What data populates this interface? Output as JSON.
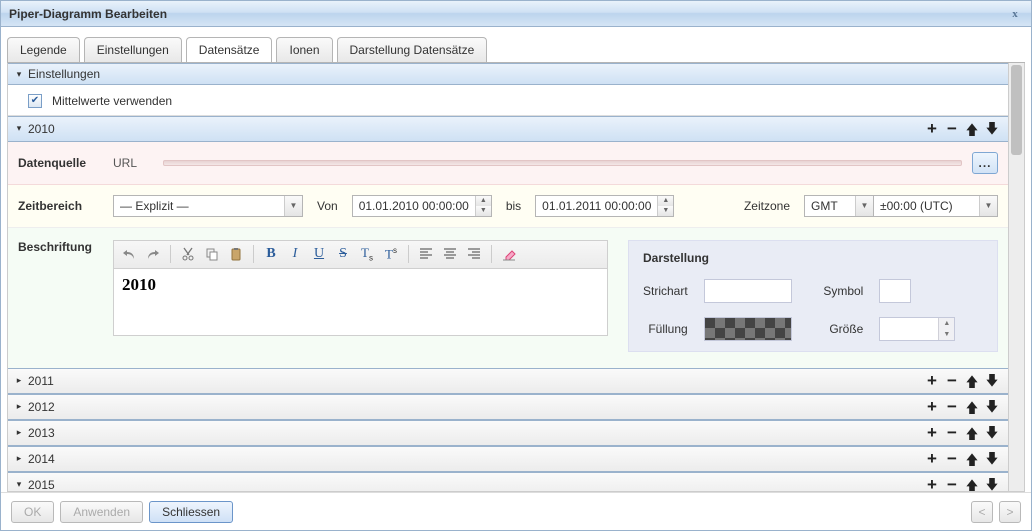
{
  "window": {
    "title": "Piper-Diagramm Bearbeiten",
    "close": "x"
  },
  "tabs": [
    "Legende",
    "Einstellungen",
    "Datensätze",
    "Ionen",
    "Darstellung Datensätze"
  ],
  "active_tab": 2,
  "settings": {
    "title": "Einstellungen",
    "useMeans": "Mittelwerte verwenden",
    "useMeansChecked": true
  },
  "ds2010": {
    "title": "2010",
    "row_url": {
      "label": "Datenquelle",
      "url_label": "URL",
      "btn": "..."
    },
    "row_time": {
      "label": "Zeitbereich",
      "mode": "— Explizit —",
      "from_label": "Von",
      "from": "01.01.2010 00:00:00",
      "to_label": "bis",
      "to": "01.01.2011 00:00:00",
      "tz_label": "Zeitzone",
      "tz": "GMT",
      "offset": "±00:00 (UTC)"
    },
    "row_caption": {
      "label": "Beschriftung",
      "text": "2010"
    },
    "display": {
      "head": "Darstellung",
      "stroke": "Strichart",
      "fill": "Füllung",
      "symbol": "Symbol",
      "size": "Größe"
    }
  },
  "collapsed": [
    "2011",
    "2012",
    "2013",
    "2014",
    "2015"
  ],
  "footer": {
    "ok": "OK",
    "apply": "Anwenden",
    "close": "Schliessen",
    "prev": "<",
    "next": ">"
  }
}
